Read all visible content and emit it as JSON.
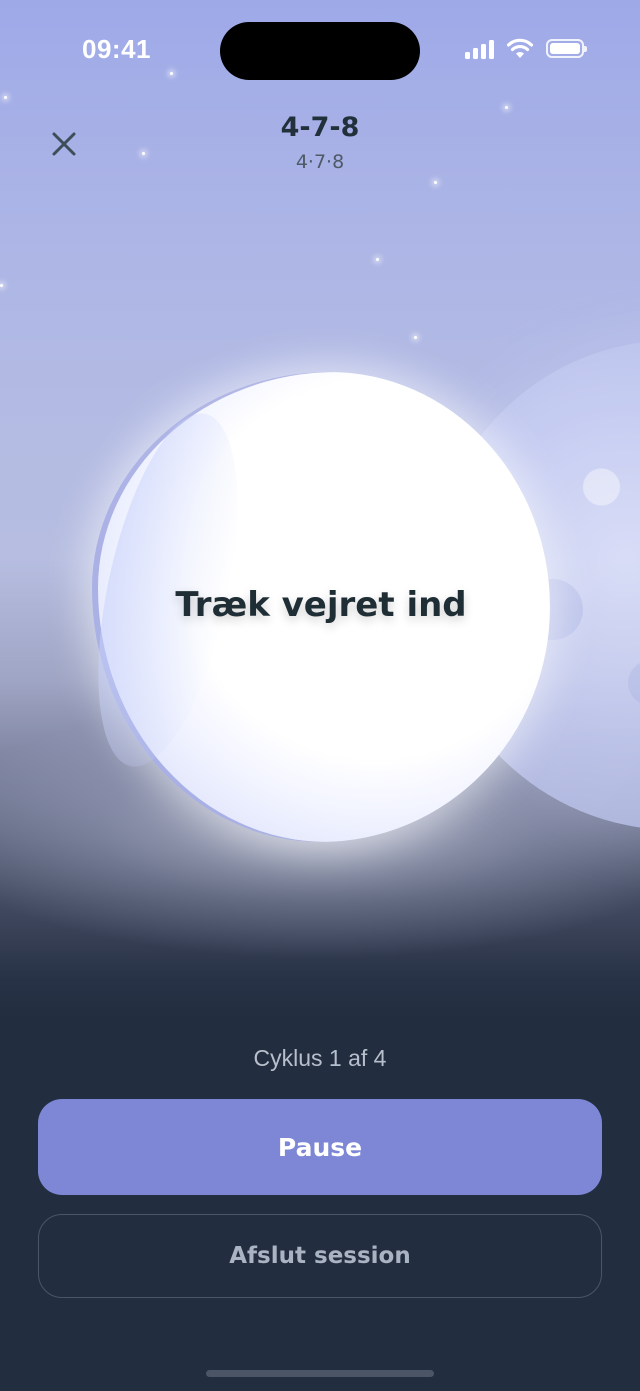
{
  "status_bar": {
    "time": "09:41"
  },
  "header": {
    "close_icon": "close-icon",
    "title": "4-7-8",
    "subtitle": "4·7·8"
  },
  "breathing": {
    "phase": "Træk vejret ind"
  },
  "controls": {
    "cycle_text": "Cyklus 1 af 4",
    "pause_label": "Pause",
    "end_label": "Afslut session"
  },
  "colors": {
    "primary_button": "#7d87d6",
    "dark_background": "#222d3f",
    "sky_top": "#9ea9e8"
  }
}
